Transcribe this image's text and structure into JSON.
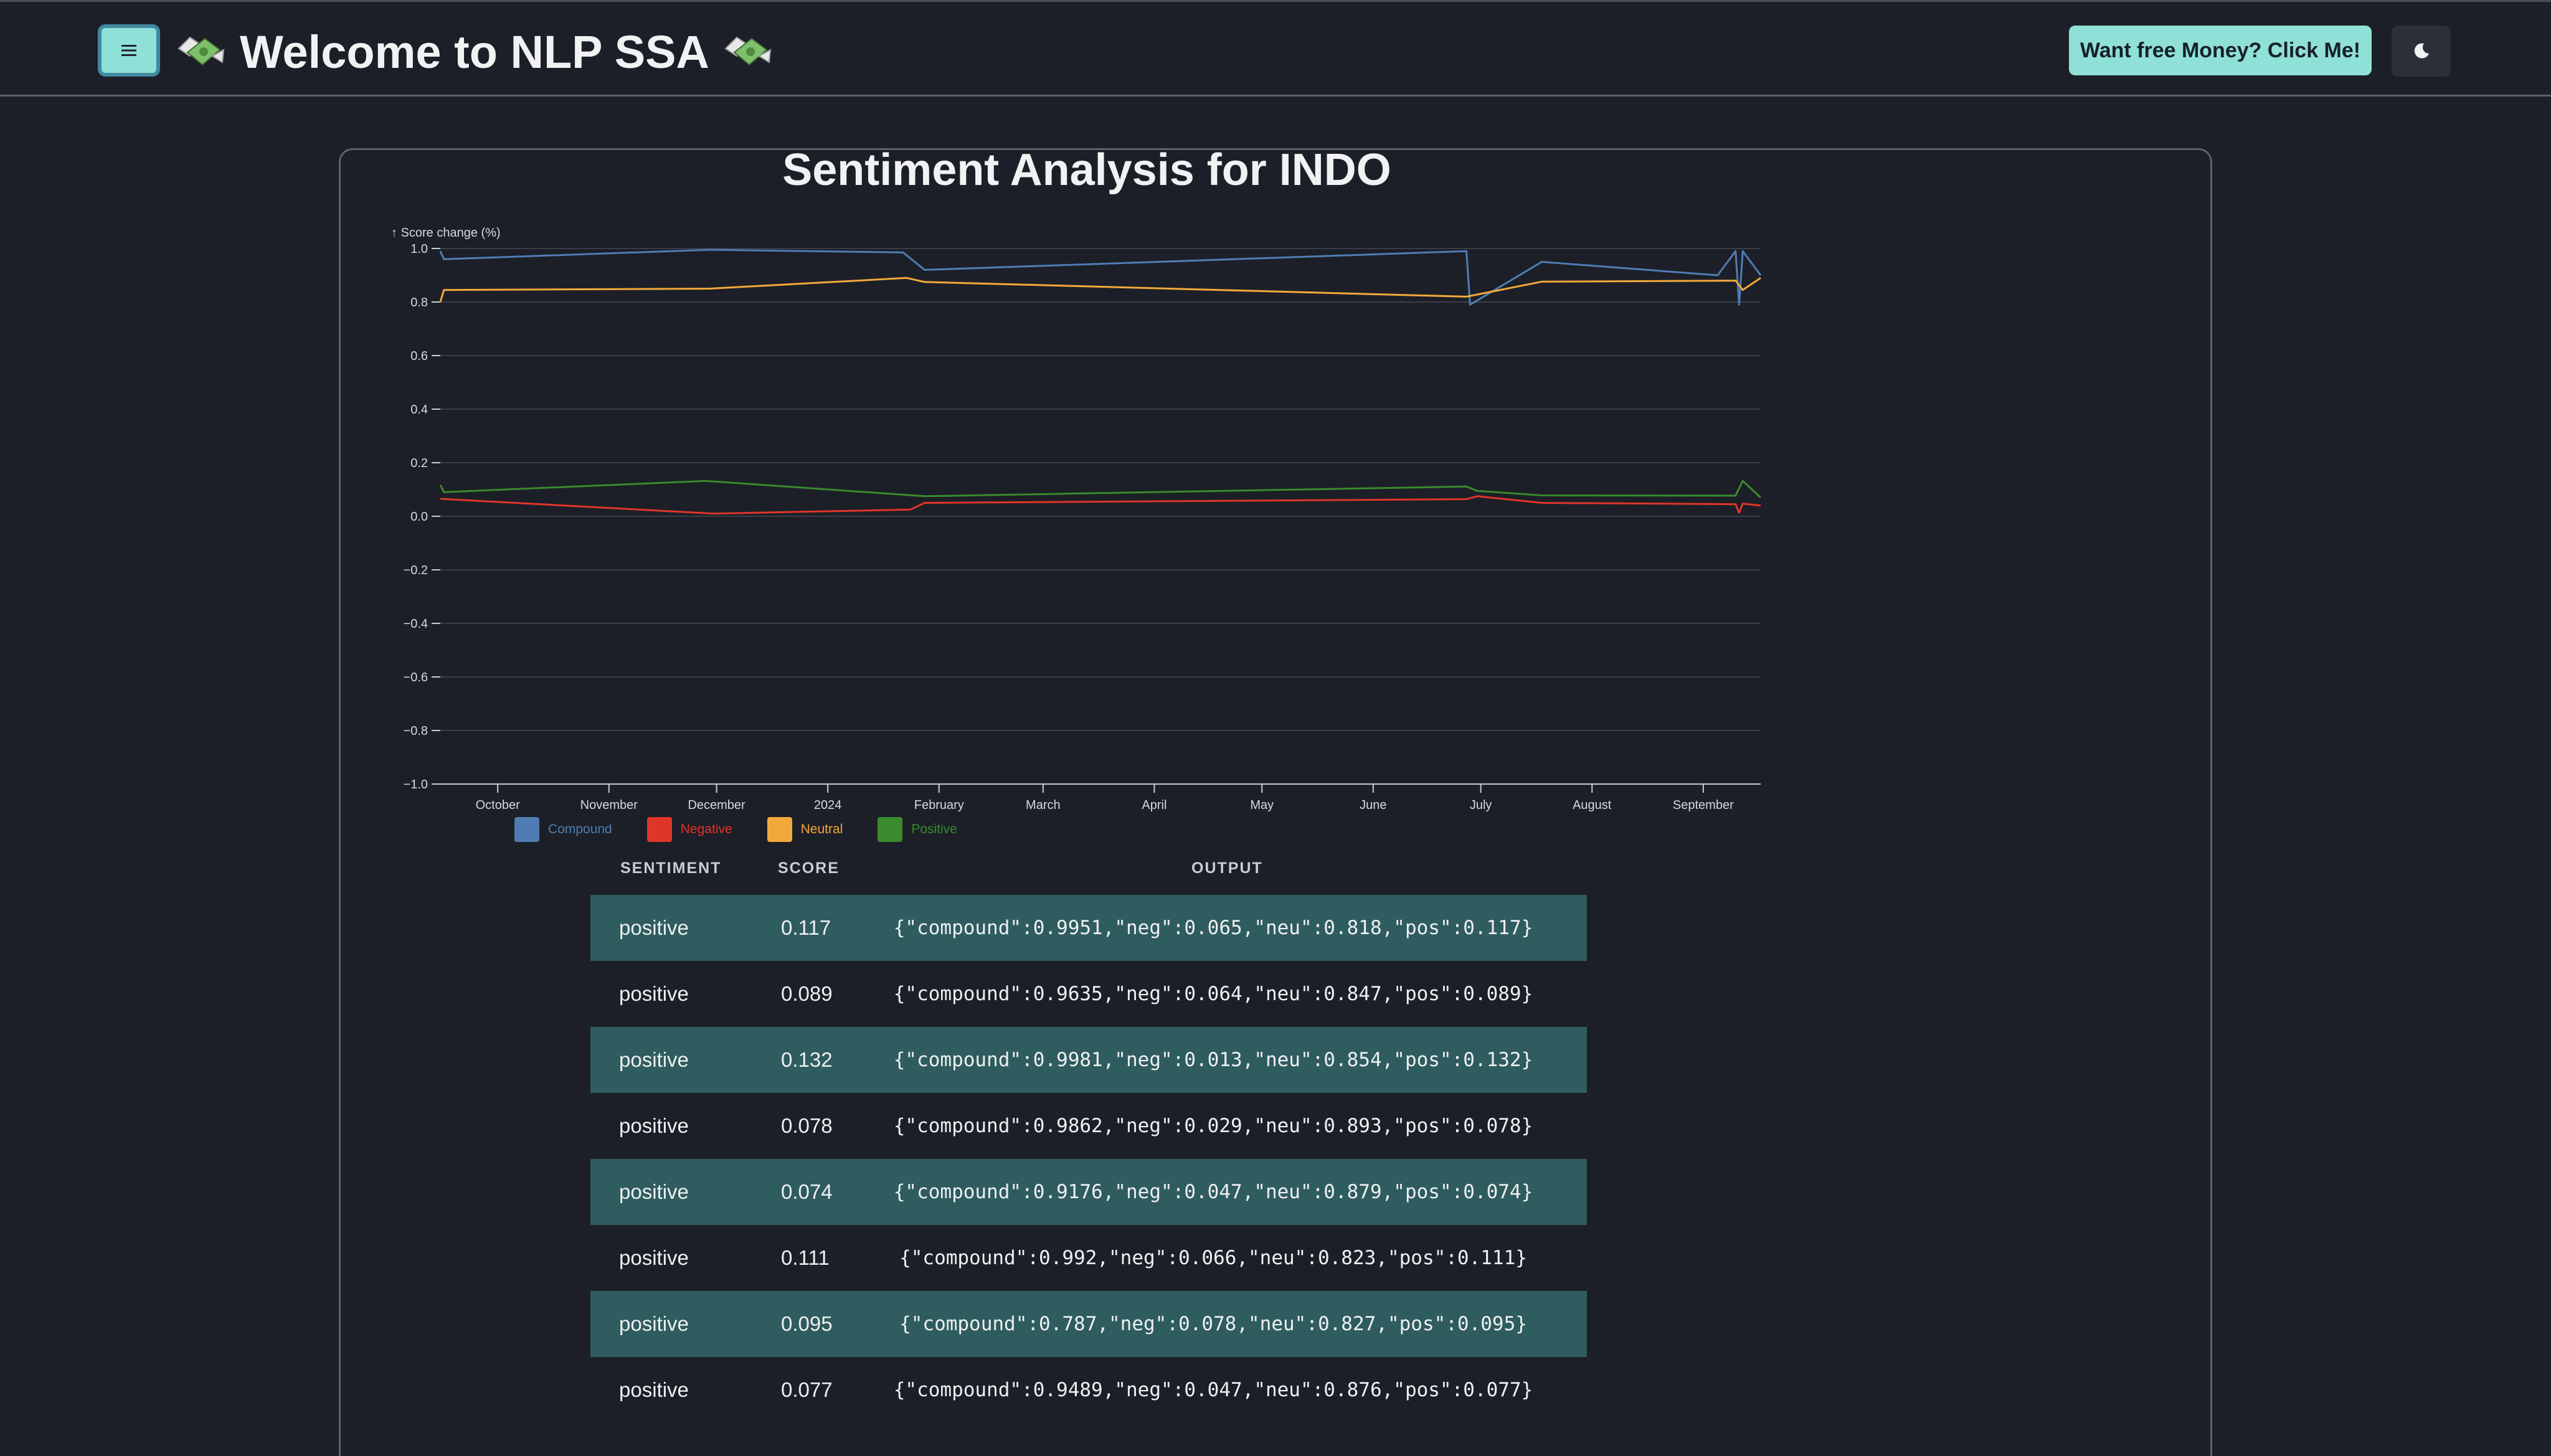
{
  "header": {
    "menu_icon": "hamburger-icon",
    "title": "Welcome to NLP SSA",
    "title_icon": "money-with-wings-icon",
    "promo_label": "Want free Money? Click Me!",
    "theme_icon": "moon-icon"
  },
  "colors": {
    "accent": "#8fe0d6",
    "background": "#1c1f27",
    "row_highlight": "#2f5c5e",
    "compound": "#4f7db3",
    "negative": "#e0352b",
    "neutral": "#f2a93b",
    "positive": "#3a8a2e"
  },
  "page": {
    "title": "Sentiment Analysis for INDO"
  },
  "chart_data": {
    "type": "line",
    "ylabel": "↑ Score change (%)",
    "ylim": [
      -1.0,
      1.0
    ],
    "yticks": [
      "1.0",
      "0.8",
      "0.6",
      "0.4",
      "0.2",
      "0.0",
      "−0.2",
      "−0.4",
      "−0.6",
      "−0.8",
      "−1.0"
    ],
    "xlim": [
      "2023-09-15",
      "2024-09-17"
    ],
    "xticks": [
      {
        "label": "October",
        "date": "2023-10-01"
      },
      {
        "label": "November",
        "date": "2023-11-01"
      },
      {
        "label": "December",
        "date": "2023-12-01"
      },
      {
        "label": "2024",
        "date": "2024-01-01"
      },
      {
        "label": "February",
        "date": "2024-02-01"
      },
      {
        "label": "March",
        "date": "2024-03-01"
      },
      {
        "label": "April",
        "date": "2024-04-01"
      },
      {
        "label": "May",
        "date": "2024-05-01"
      },
      {
        "label": "June",
        "date": "2024-06-01"
      },
      {
        "label": "July",
        "date": "2024-07-01"
      },
      {
        "label": "August",
        "date": "2024-08-01"
      },
      {
        "label": "September",
        "date": "2024-09-01"
      }
    ],
    "grid": true,
    "legend_position": "bottom-left",
    "series": [
      {
        "name": "Compound",
        "color": "#4f7db3",
        "points": [
          [
            "2023-09-15",
            0.99
          ],
          [
            "2023-09-16",
            0.96
          ],
          [
            "2023-11-29",
            0.995
          ],
          [
            "2024-01-22",
            0.985
          ],
          [
            "2024-01-28",
            0.92
          ],
          [
            "2024-06-27",
            0.99
          ],
          [
            "2024-06-28",
            0.79
          ],
          [
            "2024-07-18",
            0.95
          ],
          [
            "2024-09-05",
            0.9
          ],
          [
            "2024-09-10",
            0.99
          ],
          [
            "2024-09-11",
            0.79
          ],
          [
            "2024-09-12",
            0.99
          ],
          [
            "2024-09-17",
            0.9
          ]
        ]
      },
      {
        "name": "Negative",
        "color": "#e0352b",
        "points": [
          [
            "2023-09-15",
            0.065
          ],
          [
            "2023-11-30",
            0.01
          ],
          [
            "2024-01-24",
            0.025
          ],
          [
            "2024-01-28",
            0.05
          ],
          [
            "2024-06-27",
            0.064
          ],
          [
            "2024-06-30",
            0.075
          ],
          [
            "2024-07-18",
            0.05
          ],
          [
            "2024-09-10",
            0.045
          ],
          [
            "2024-09-11",
            0.013
          ],
          [
            "2024-09-12",
            0.047
          ],
          [
            "2024-09-17",
            0.04
          ]
        ]
      },
      {
        "name": "Neutral",
        "color": "#f2a93b",
        "points": [
          [
            "2023-09-15",
            0.8
          ],
          [
            "2023-09-16",
            0.845
          ],
          [
            "2023-11-29",
            0.85
          ],
          [
            "2024-01-23",
            0.89
          ],
          [
            "2024-01-28",
            0.875
          ],
          [
            "2024-06-27",
            0.82
          ],
          [
            "2024-07-18",
            0.876
          ],
          [
            "2024-09-10",
            0.88
          ],
          [
            "2024-09-12",
            0.845
          ],
          [
            "2024-09-17",
            0.89
          ]
        ]
      },
      {
        "name": "Positive",
        "color": "#3a8a2e",
        "points": [
          [
            "2023-09-15",
            0.117
          ],
          [
            "2023-09-16",
            0.09
          ],
          [
            "2023-11-28",
            0.132
          ],
          [
            "2024-01-28",
            0.075
          ],
          [
            "2024-06-27",
            0.111
          ],
          [
            "2024-06-30",
            0.095
          ],
          [
            "2024-07-18",
            0.078
          ],
          [
            "2024-09-10",
            0.077
          ],
          [
            "2024-09-12",
            0.132
          ],
          [
            "2024-09-17",
            0.07
          ]
        ]
      }
    ]
  },
  "table": {
    "headers": [
      "SENTIMENT",
      "SCORE",
      "OUTPUT"
    ],
    "rows": [
      {
        "sentiment": "positive",
        "score": "0.117",
        "output": "{\"compound\":0.9951,\"neg\":0.065,\"neu\":0.818,\"pos\":0.117}",
        "highlight": true
      },
      {
        "sentiment": "positive",
        "score": "0.089",
        "output": "{\"compound\":0.9635,\"neg\":0.064,\"neu\":0.847,\"pos\":0.089}",
        "highlight": false
      },
      {
        "sentiment": "positive",
        "score": "0.132",
        "output": "{\"compound\":0.9981,\"neg\":0.013,\"neu\":0.854,\"pos\":0.132}",
        "highlight": true
      },
      {
        "sentiment": "positive",
        "score": "0.078",
        "output": "{\"compound\":0.9862,\"neg\":0.029,\"neu\":0.893,\"pos\":0.078}",
        "highlight": false
      },
      {
        "sentiment": "positive",
        "score": "0.074",
        "output": "{\"compound\":0.9176,\"neg\":0.047,\"neu\":0.879,\"pos\":0.074}",
        "highlight": true
      },
      {
        "sentiment": "positive",
        "score": "0.111",
        "output": "{\"compound\":0.992,\"neg\":0.066,\"neu\":0.823,\"pos\":0.111}",
        "highlight": false
      },
      {
        "sentiment": "positive",
        "score": "0.095",
        "output": "{\"compound\":0.787,\"neg\":0.078,\"neu\":0.827,\"pos\":0.095}",
        "highlight": true
      },
      {
        "sentiment": "positive",
        "score": "0.077",
        "output": "{\"compound\":0.9489,\"neg\":0.047,\"neu\":0.876,\"pos\":0.077}",
        "highlight": false
      }
    ]
  }
}
